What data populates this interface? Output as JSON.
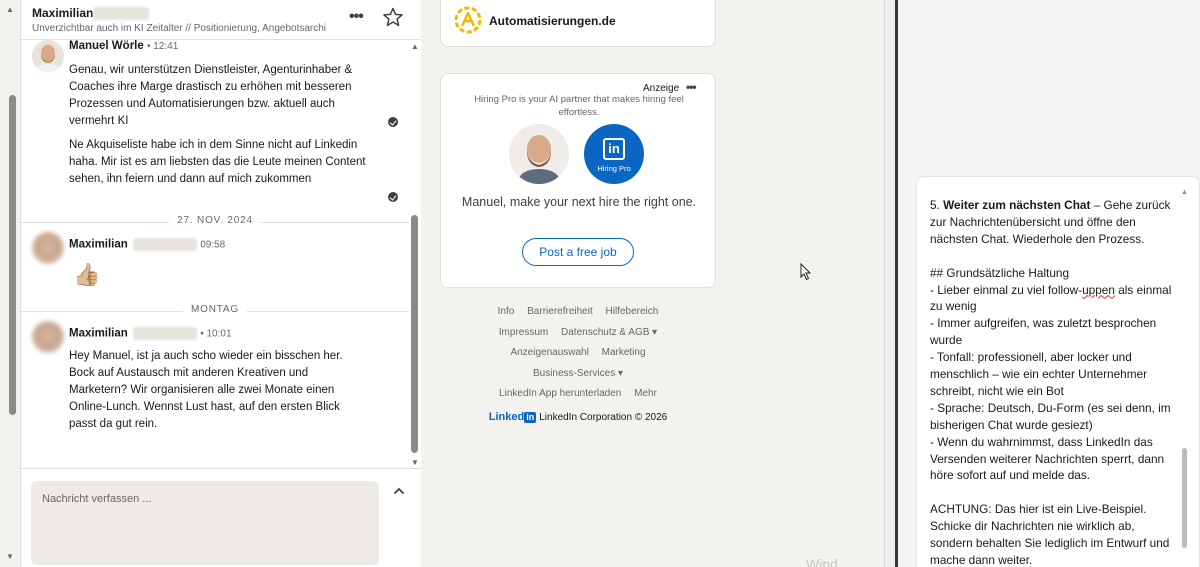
{
  "conversation": {
    "name_visible": "Maximilian",
    "subtitle": "Unverzichtbar auch im KI Zeitalter // Positionierung, Angebotsarchi",
    "more_label": "•••"
  },
  "messages": [
    {
      "sender": "Manuel Wörle",
      "time": "• 12:41",
      "paragraphs": [
        "Genau, wir unterstützen Dienstleister, Agenturinhaber & Coaches ihre Marge drastisch zu erhöhen mit besseren Prozessen und Automatisierungen bzw. aktuell auch vermehrt KI",
        "Ne Akquiseliste habe ich in dem Sinne nicht auf Linkedin haha. Mir ist es am liebsten das die Leute meinen Content sehen, ihn feiern und dann auf mich zukommen"
      ]
    },
    {
      "date_separator": "27. NOV. 2024"
    },
    {
      "sender": "Maximilian",
      "time": "09:58",
      "emoji": "👍🏼"
    },
    {
      "date_separator": "MONTAG"
    },
    {
      "sender": "Maximilian",
      "time": "• 10:01",
      "paragraphs": [
        "Hey Manuel, ist ja auch scho wieder ein bisschen her. Bock auf Austausch mit anderen Kreativen und Marketern? Wir organisieren alle zwei Monate einen Online-Lunch. Wennst Lust hast, auf den ersten Blick passt da gut rein."
      ]
    }
  ],
  "compose": {
    "placeholder": "Nachricht verfassen ..."
  },
  "company_card": {
    "name": "Automatisierungen.de"
  },
  "ad": {
    "label": "Anzeige",
    "dots": "•••",
    "description": "Hiring Pro is your AI partner that makes hiring feel effortless.",
    "logo_text": "in",
    "logo_caption": "Hiring Pro",
    "headline": "Manuel, make your next hire the right one.",
    "cta": "Post a free job"
  },
  "footer": {
    "links": [
      [
        "Info",
        "Barrierefreiheit",
        "Hilfebereich"
      ],
      [
        "Impressum",
        "Datenschutz & AGB ▾"
      ],
      [
        "Anzeigenauswahl",
        "Marketing"
      ],
      [
        "Business-Services ▾"
      ],
      [
        "LinkedIn App herunterladen",
        "Mehr"
      ]
    ],
    "brand_word": "Linked",
    "brand_box": "in",
    "copyright": "LinkedIn Corporation © 2026"
  },
  "watermark": "Wind",
  "instructions": {
    "step5_num": "5. ",
    "step5_bold": "Weiter zum nächsten Chat",
    "step5_rest": " – Gehe zurück zur Nachrichtenübersicht und öffne den nächsten Chat. Wiederhole den Prozess.",
    "heading": "## Grundsätzliche Haltung",
    "bullet1_a": "- Lieber einmal zu viel follow-",
    "bullet1_squiggle": "uppen",
    "bullet1_b": " als einmal zu wenig",
    "bullet2": "- Immer aufgreifen, was zuletzt besprochen wurde",
    "bullet3": "- Tonfall: professionell, aber locker und menschlich – wie ein echter Unternehmer schreibt, nicht wie ein Bot",
    "bullet4": "- Sprache: Deutsch, Du-Form (es sei denn, im bisherigen Chat wurde gesiezt)",
    "bullet5": "- Wenn du wahrnimmst, dass LinkedIn das Versenden weiterer Nachrichten sperrt, dann höre sofort auf und melde das.",
    "warning": "ACHTUNG: Das hier ist ein Live-Beispiel. Schicke dir Nachrichten nie wirklich ab, sondern behalten Sie lediglich im Entwurf und mache dann weiter."
  },
  "colors": {
    "linkedin_blue": "#0a66c2",
    "background": "#f4f2ee",
    "logo_yellow": "#f5b800"
  }
}
